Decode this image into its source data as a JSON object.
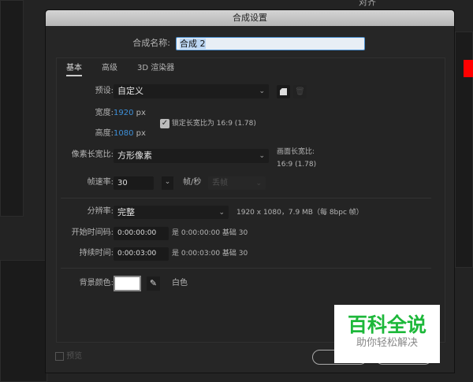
{
  "background": {
    "top_panel_label": "对齐",
    "accent_swatch": "#ff0000"
  },
  "dialog": {
    "title": "合成设置",
    "comp_name_label": "合成名称:",
    "comp_name_value": "合成 2",
    "tabs": [
      {
        "label": "基本",
        "active": true
      },
      {
        "label": "高级"
      },
      {
        "label": "3D 渲染器"
      }
    ],
    "preset_label": "预设:",
    "preset_value": "自定义",
    "width_label": "宽度:",
    "width_value": "1920",
    "width_unit": "px",
    "height_label": "高度:",
    "height_value": "1080",
    "height_unit": "px",
    "lock_aspect": {
      "label": "锁定长宽比为 16:9 (1.78)",
      "checked": true
    },
    "pixel_aspect_label": "像素长宽比:",
    "pixel_aspect_value": "方形像素",
    "frame_aspect_label": "画面长宽比:",
    "frame_aspect_value": "16:9 (1.78)",
    "frame_rate_label": "帧速率:",
    "frame_rate_value": "30",
    "frame_rate_unit": "帧/秒",
    "drop_frame_value": "丢帧",
    "resolution_label": "分辨率:",
    "resolution_value": "完整",
    "resolution_info": "1920 x 1080，7.9 MB（每 8bpc 帧）",
    "start_tc_label": "开始时间码:",
    "start_tc_value": "0:00:00:00",
    "start_tc_info": "是 0:00:00:00 基础 30",
    "duration_label": "持续时间:",
    "duration_value": "0:00:03:00",
    "duration_info": "是 0:00:03:00 基础 30",
    "bg_color_label": "背景颜色:",
    "bg_color": "#ffffff",
    "bg_color_name": "白色",
    "preview_label": "预览",
    "preview_checked": false
  },
  "watermark": {
    "title": "百科全说",
    "subtitle": "助你轻松解决",
    "color": "#1db83a"
  }
}
